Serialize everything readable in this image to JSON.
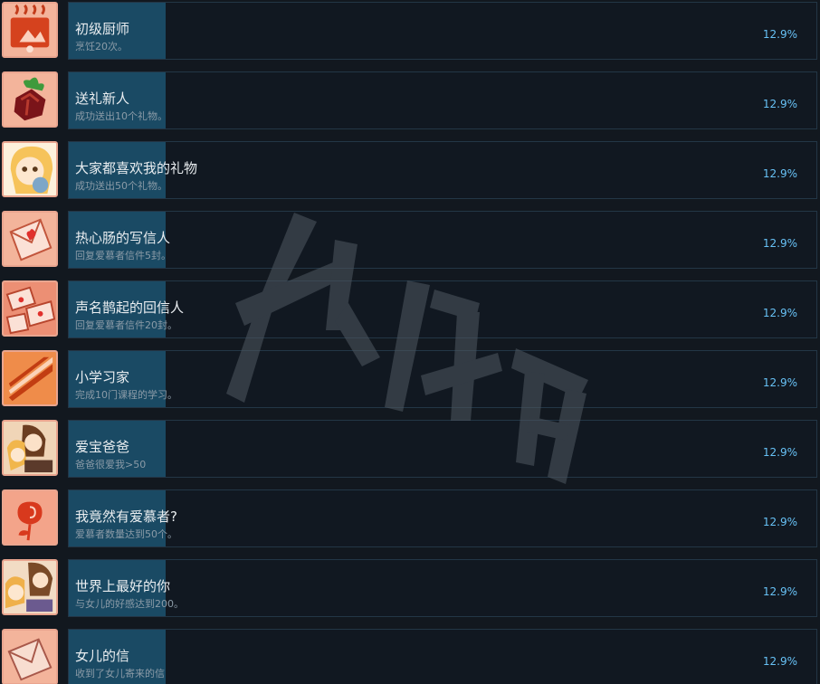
{
  "achievements": [
    {
      "title": "初级厨师",
      "description": "烹饪20次。",
      "percent": "12.9%",
      "percent_value": 12.9,
      "icon": "cooking-stove-icon"
    },
    {
      "title": "送礼新人",
      "description": "成功送出10个礼物。",
      "percent": "12.9%",
      "percent_value": 12.9,
      "icon": "gift-box-icon"
    },
    {
      "title": "大家都喜欢我的礼物",
      "description": "成功送出50个礼物。",
      "percent": "12.9%",
      "percent_value": 12.9,
      "icon": "girl-with-yarn-icon"
    },
    {
      "title": "热心肠的写信人",
      "description": "回复爱慕者信件5封。",
      "percent": "12.9%",
      "percent_value": 12.9,
      "icon": "love-letter-icon"
    },
    {
      "title": "声名鹊起的回信人",
      "description": "回复爱慕者信件20封。",
      "percent": "12.9%",
      "percent_value": 12.9,
      "icon": "many-letters-icon"
    },
    {
      "title": "小学习家",
      "description": "完成10门课程的学习。",
      "percent": "12.9%",
      "percent_value": 12.9,
      "icon": "books-icon"
    },
    {
      "title": "爱宝爸爸",
      "description": "爸爸很爱我>50",
      "percent": "12.9%",
      "percent_value": 12.9,
      "icon": "father-daughter-icon"
    },
    {
      "title": "我竟然有爱慕者?",
      "description": "爱慕者数量达到50个。",
      "percent": "12.9%",
      "percent_value": 12.9,
      "icon": "rose-icon"
    },
    {
      "title": "世界上最好的你",
      "description": "与女儿的好感达到200。",
      "percent": "12.9%",
      "percent_value": 12.9,
      "icon": "family-hug-icon"
    },
    {
      "title": "女儿的信",
      "description": "收到了女儿寄来的信",
      "percent": "12.9%",
      "percent_value": 12.9,
      "icon": "envelope-icon"
    }
  ],
  "colors": {
    "background": "#12181f",
    "progress_fill": "#1a4a64",
    "percent_text": "#67c1f5",
    "icon_background": "#f4c0ae"
  }
}
